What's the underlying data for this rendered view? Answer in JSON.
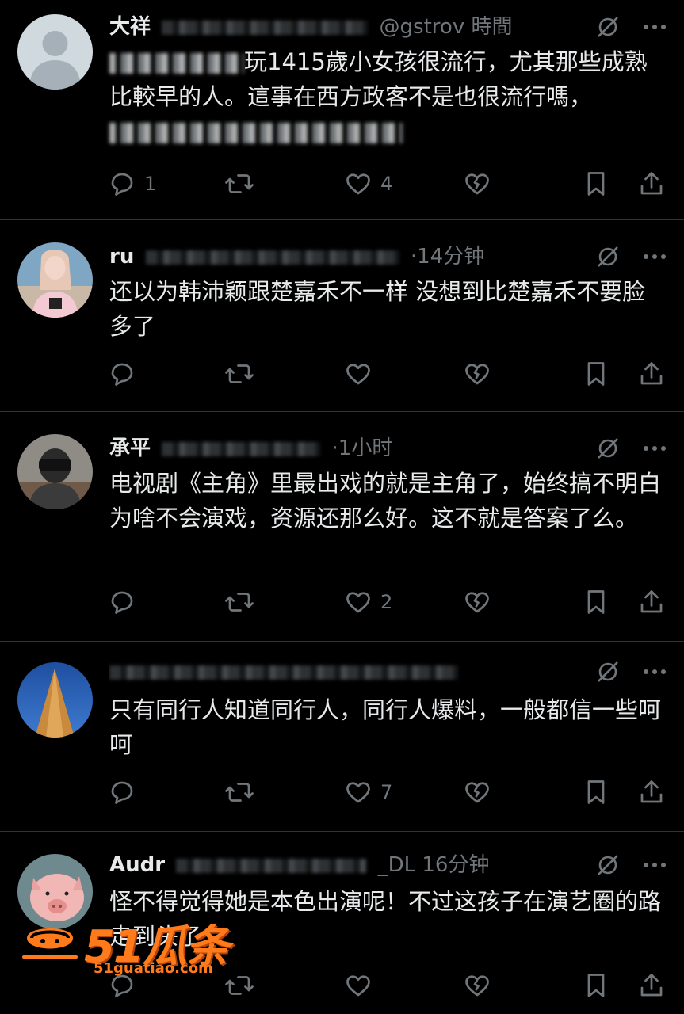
{
  "replies": [
    {
      "id": "r1",
      "header": {
        "name": "大祥",
        "handle": "@gstrov",
        "time": "時間"
      },
      "text_lead": "",
      "text": "玩1415歲小女孩很流行，尤其那些成熟比較早的人。這事在西方政客不是也很流行嗎，",
      "counts": {
        "reply": "1",
        "retweet": "",
        "like": "4"
      }
    },
    {
      "id": "r2",
      "header": {
        "name": "ru",
        "handle": "",
        "time": "·14分钟"
      },
      "text_lead": "",
      "text": "还以为韩沛颖跟楚嘉禾不一样 没想到比楚嘉禾不要脸多了",
      "counts": {
        "reply": "",
        "retweet": "",
        "like": ""
      }
    },
    {
      "id": "r3",
      "header": {
        "name": "承平",
        "handle": "",
        "time": "·1小时"
      },
      "text_lead": "",
      "text": "电视剧《主角》里最出戏的就是主角了，始终搞不明白为啥不会演戏，资源还那么好。这不就是答案了么。",
      "counts": {
        "reply": "",
        "retweet": "",
        "like": "2"
      }
    },
    {
      "id": "r4",
      "header": {
        "name": "",
        "handle": "",
        "time": ""
      },
      "text_lead": "",
      "text": "只有同行人知道同行人，同行人爆料，一般都信一些呵呵",
      "counts": {
        "reply": "",
        "retweet": "",
        "like": "7"
      }
    },
    {
      "id": "r5",
      "header": {
        "name": "Audr",
        "handle": "_DL",
        "time": "16分钟"
      },
      "text_lead": "",
      "text": "怪不得觉得她是本色出演呢！不过这孩子在演艺圈的路走到头了",
      "counts": {
        "reply": "",
        "retweet": "",
        "like": ""
      }
    }
  ],
  "watermark": {
    "logo": "51瓜条",
    "url": "51guatiao.com"
  },
  "icons": [
    "grok-slash-icon",
    "more-dots-icon",
    "reply-icon",
    "retweet-icon",
    "like-icon",
    "dislike-icon",
    "bookmark-icon",
    "share-icon"
  ],
  "colors": {
    "background": "#000000",
    "text": "#e7e9ea",
    "muted": "#71767b",
    "divider": "#2f3336",
    "watermark": "#ff7a1a"
  }
}
